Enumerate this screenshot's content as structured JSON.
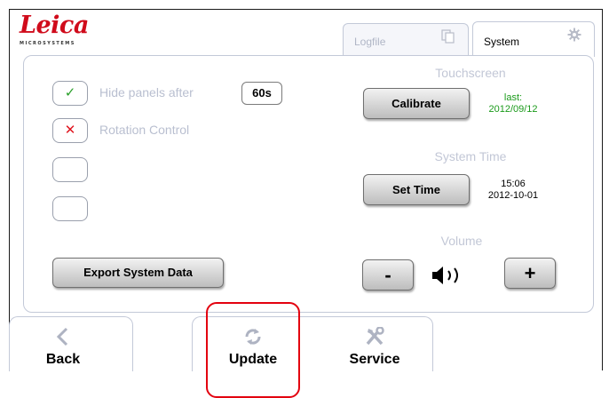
{
  "brand": {
    "logo": "Leica",
    "sub": "MICROSYSTEMS"
  },
  "tabs": {
    "logfile": "Logfile",
    "system": "System"
  },
  "options": {
    "hide_panels_label": "Hide panels after",
    "hide_panels_value": "60s",
    "rotation_label": "Rotation Control",
    "hide_panels_mark": "✓",
    "rotation_mark": "✕"
  },
  "touchscreen": {
    "label": "Touchscreen",
    "button": "Calibrate",
    "last_label": "last:",
    "last_date": "2012/09/12"
  },
  "system_time": {
    "label": "System Time",
    "button": "Set Time",
    "time": "15:06",
    "date": "2012-10-01"
  },
  "volume": {
    "label": "Volume",
    "minus": "-",
    "plus": "+"
  },
  "export_button": "Export System Data",
  "nav": {
    "back": "Back",
    "update": "Update",
    "service": "Service"
  },
  "colors": {
    "brand_red": "#d00b1b",
    "check_green": "#2aa02a",
    "cross_red": "#e0141e",
    "date_green": "#1a9a1a",
    "highlight": "#e3000f"
  }
}
